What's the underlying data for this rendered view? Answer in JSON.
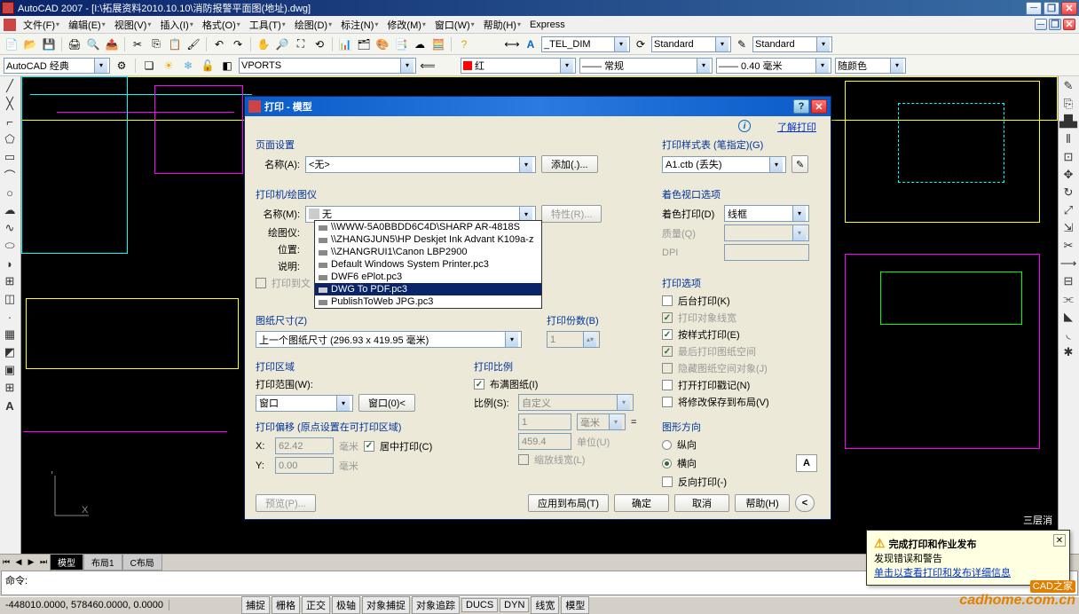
{
  "title_bar": "AutoCAD 2007 - [I:\\拓展资料2010.10.10\\消防报警平面图(地址).dwg]",
  "menu": [
    "文件(F)",
    "编辑(E)",
    "视图(V)",
    "插入(I)",
    "格式(O)",
    "工具(T)",
    "绘图(D)",
    "标注(N)",
    "修改(M)",
    "窗口(W)",
    "帮助(H)",
    "Express"
  ],
  "combo_style": "AutoCAD 经典",
  "combo_vports": "VPORTS",
  "combo_color": "红",
  "combo_dim": "_TEL_DIM",
  "combo_std1": "Standard",
  "combo_std2": "Standard",
  "combo_ltype": "—— 常规",
  "combo_lw": "—— 0.40 毫米",
  "combo_bycolor": "随颜色",
  "tabs": {
    "model": "模型",
    "layout1": "布局1",
    "layout2": "C布局"
  },
  "cmd": "命令:",
  "status_coord": "-448010.0000, 578460.0000, 0.0000",
  "status_btns": [
    "捕捉",
    "栅格",
    "正交",
    "极轴",
    "对象捕捉",
    "对象追踪",
    "DUCS",
    "DYN",
    "线宽",
    "模型"
  ],
  "ucs": {
    "x": "X",
    "y": "Y"
  },
  "canvas_label": "三层消",
  "dialog": {
    "title": "打印 - 模型",
    "help_link": "了解打印",
    "page_setup": "页面设置",
    "name_lbl": "名称(A):",
    "name_val": "<无>",
    "add_btn": "添加(.)...",
    "style_table": "打印样式表 (笔指定)(G)",
    "style_val": "A1.ctb (丢失)",
    "printer_section": "打印机/绘图仪",
    "p_name_lbl": "名称(M):",
    "p_name_val": "无",
    "props_btn": "特性(R)...",
    "plotter_lbl": "绘图仪:",
    "where_lbl": "位置:",
    "desc_lbl": "说明:",
    "print_to_file": "打印到文",
    "printer_options": [
      "\\\\WWW-5A0BBDD6C4D\\SHARP AR-4818S",
      "\\\\ZHANGJUN5\\HP Deskjet Ink Advant K109a-z",
      "\\\\ZHANGRUI1\\Canon LBP2900",
      "Default Windows System Printer.pc3",
      "DWF6 ePlot.pc3",
      "DWG To PDF.pc3",
      "PublishToWeb JPG.pc3"
    ],
    "viewport_section": "着色视口选项",
    "shade_lbl": "着色打印(D)",
    "shade_val": "线框",
    "quality_lbl": "质量(Q)",
    "dpi_lbl": "DPI",
    "paper_section": "图纸尺寸(Z)",
    "paper_val": "上一个图纸尺寸 (296.93 x 419.95 毫米)",
    "copies_lbl": "打印份数(B)",
    "copies_val": "1",
    "options_section": "打印选项",
    "opt_bg": "后台打印(K)",
    "opt_lw": "打印对象线宽",
    "opt_style": "按样式打印(E)",
    "opt_paperspace": "最后打印图纸空间",
    "opt_hide": "隐藏图纸空间对象(J)",
    "opt_stamp": "打开打印戳记(N)",
    "opt_save": "将修改保存到布局(V)",
    "area_section": "打印区域",
    "area_lbl": "打印范围(W):",
    "area_val": "窗口",
    "window_btn": "窗口(0)<",
    "scale_section": "打印比例",
    "fit_paper": "布满图纸(I)",
    "scale_lbl": "比例(S):",
    "scale_val": "自定义",
    "scale_unit1_val": "1",
    "scale_unit1": "毫米",
    "scale_unit2_val": "459.4",
    "scale_unit2": "单位(U)",
    "scale_lw": "缩放线宽(L)",
    "offset_section": "打印偏移 (原点设置在可打印区域)",
    "offset_x": "X:",
    "offset_x_val": "62.42",
    "offset_y": "Y:",
    "offset_y_val": "0.00",
    "offset_unit": "毫米",
    "center": "居中打印(C)",
    "orient_section": "图形方向",
    "orient_portrait": "纵向",
    "orient_landscape": "横向",
    "orient_upside": "反向打印(-)",
    "preview_btn": "预览(P)...",
    "apply_btn": "应用到布局(T)",
    "ok_btn": "确定",
    "cancel_btn": "取消",
    "help_btn": "帮助(H)"
  },
  "notif": {
    "title": "完成打印和作业发布",
    "msg": "发现错误和警告",
    "link": "单击以查看打印和发布详细信息"
  },
  "watermark_brand": "CAD之家",
  "watermark_url": "cadhome.com.cn"
}
